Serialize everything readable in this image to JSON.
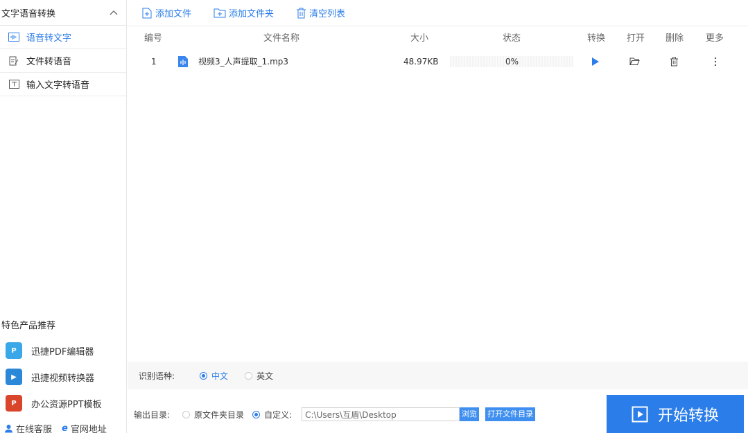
{
  "sidebar": {
    "header": "文字语音转换",
    "items": [
      {
        "label": "语音转文字",
        "icon": "audio-wave-icon",
        "active": true
      },
      {
        "label": "文件转语音",
        "icon": "file-edit-icon",
        "active": false
      },
      {
        "label": "输入文字转语音",
        "icon": "text-box-icon",
        "active": false
      }
    ],
    "promo_title": "特色产品推荐",
    "promos": [
      {
        "label": "迅捷PDF编辑器",
        "icon": "pdf-editor-logo-icon"
      },
      {
        "label": "迅捷视频转换器",
        "icon": "video-converter-logo-icon"
      },
      {
        "label": "办公资源PPT模板",
        "icon": "ppt-template-logo-icon"
      }
    ],
    "links": {
      "service": "在线客服",
      "website": "官网地址"
    }
  },
  "toolbar": {
    "add_file": "添加文件",
    "add_folder": "添加文件夹",
    "clear_list": "清空列表"
  },
  "table": {
    "headers": {
      "index": "编号",
      "name": "文件名称",
      "size": "大小",
      "status": "状态",
      "convert": "转换",
      "open": "打开",
      "delete": "删除",
      "more": "更多"
    },
    "rows": [
      {
        "index": "1",
        "name": "视频3_人声提取_1.mp3",
        "size": "48.97KB",
        "status": "0%",
        "progress": 0
      }
    ]
  },
  "bottom": {
    "lang_label": "识别语种:",
    "lang_options": {
      "zh": "中文",
      "en": "英文"
    },
    "lang_selected": "zh",
    "output_label": "输出目录:",
    "output_original": "原文件夹目录",
    "output_custom": "自定义:",
    "output_path": "C:\\Users\\互盾\\Desktop",
    "browse": "浏览",
    "open_dir": "打开文件目录",
    "start": "开始转换"
  },
  "colors": {
    "accent": "#2b7de9"
  }
}
